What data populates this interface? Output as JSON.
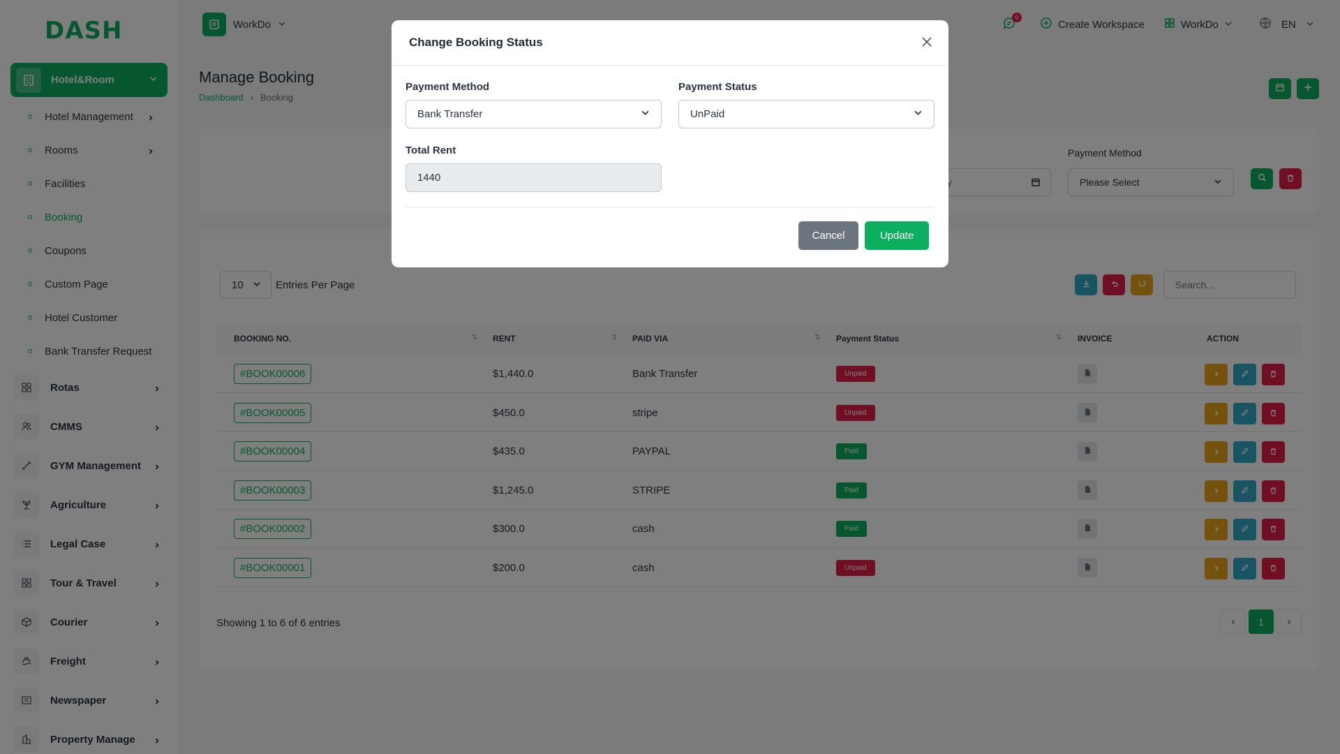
{
  "logo": {
    "part1": "DASH",
    "part2": ""
  },
  "sidebar": {
    "active_section": "Hotel&Room",
    "sub_items": [
      {
        "label": "Hotel Management",
        "has_children": true
      },
      {
        "label": "Rooms",
        "has_children": true
      },
      {
        "label": "Facilities",
        "has_children": false
      },
      {
        "label": "Booking",
        "has_children": false,
        "active": true
      },
      {
        "label": "Coupons",
        "has_children": false
      },
      {
        "label": "Custom Page",
        "has_children": false
      },
      {
        "label": "Hotel Customer",
        "has_children": false
      },
      {
        "label": "Bank Transfer Request",
        "has_children": false
      }
    ],
    "main_items": [
      {
        "label": "Rotas",
        "icon": "grid-icon"
      },
      {
        "label": "CMMS",
        "icon": "users-icon"
      },
      {
        "label": "GYM Management",
        "icon": "dumbbell-icon"
      },
      {
        "label": "Agriculture",
        "icon": "plant-icon"
      },
      {
        "label": "Legal Case",
        "icon": "list-icon"
      },
      {
        "label": "Tour & Travel",
        "icon": "grid-icon"
      },
      {
        "label": "Courier",
        "icon": "box-icon"
      },
      {
        "label": "Freight",
        "icon": "ship-icon"
      },
      {
        "label": "Newspaper",
        "icon": "newspaper-icon"
      },
      {
        "label": "Property Manage",
        "icon": "building-icon"
      }
    ]
  },
  "header": {
    "workspace": "WorkDo",
    "notification_count": "0",
    "create_workspace": "Create Workspace",
    "workspace_menu": "WorkDo",
    "language": "EN"
  },
  "page": {
    "title": "Manage Booking",
    "breadcrumb": [
      "Dashboard",
      "Booking"
    ]
  },
  "filters": {
    "date_placeholder": "y",
    "payment_method_label": "Payment Method",
    "payment_method_value": "Please Select"
  },
  "table": {
    "entries_value": "10",
    "entries_label": "Entries Per Page",
    "search_placeholder": "Search...",
    "columns": [
      "BOOKING NO.",
      "RENT",
      "PAID VIA",
      "Payment Status",
      "INVOICE",
      "ACTION"
    ],
    "rows": [
      {
        "booking_no": "#BOOK00006",
        "rent": "$1,440.0",
        "paid_via": "Bank Transfer",
        "status": "Unpaid"
      },
      {
        "booking_no": "#BOOK00005",
        "rent": "$450.0",
        "paid_via": "stripe",
        "status": "Unpaid"
      },
      {
        "booking_no": "#BOOK00004",
        "rent": "$435.0",
        "paid_via": "PAYPAL",
        "status": "Paid"
      },
      {
        "booking_no": "#BOOK00003",
        "rent": "$1,245.0",
        "paid_via": "STRIPE",
        "status": "Paid"
      },
      {
        "booking_no": "#BOOK00002",
        "rent": "$300.0",
        "paid_via": "cash",
        "status": "Paid"
      },
      {
        "booking_no": "#BOOK00001",
        "rent": "$200.0",
        "paid_via": "cash",
        "status": "Unpaid"
      }
    ],
    "showing": "Showing 1 to 6 of 6 entries",
    "current_page": "1"
  },
  "modal": {
    "title": "Change Booking Status",
    "payment_method_label": "Payment Method",
    "payment_method_value": "Bank Transfer",
    "payment_status_label": "Payment Status",
    "payment_status_value": "UnPaid",
    "total_rent_label": "Total Rent",
    "total_rent_value": "1440",
    "cancel_label": "Cancel",
    "update_label": "Update"
  },
  "colors": {
    "primary": "#0caf60",
    "danger": "#e11d48",
    "warning": "#e9a319",
    "info": "#31a8c4",
    "secondary": "#6c757d"
  }
}
